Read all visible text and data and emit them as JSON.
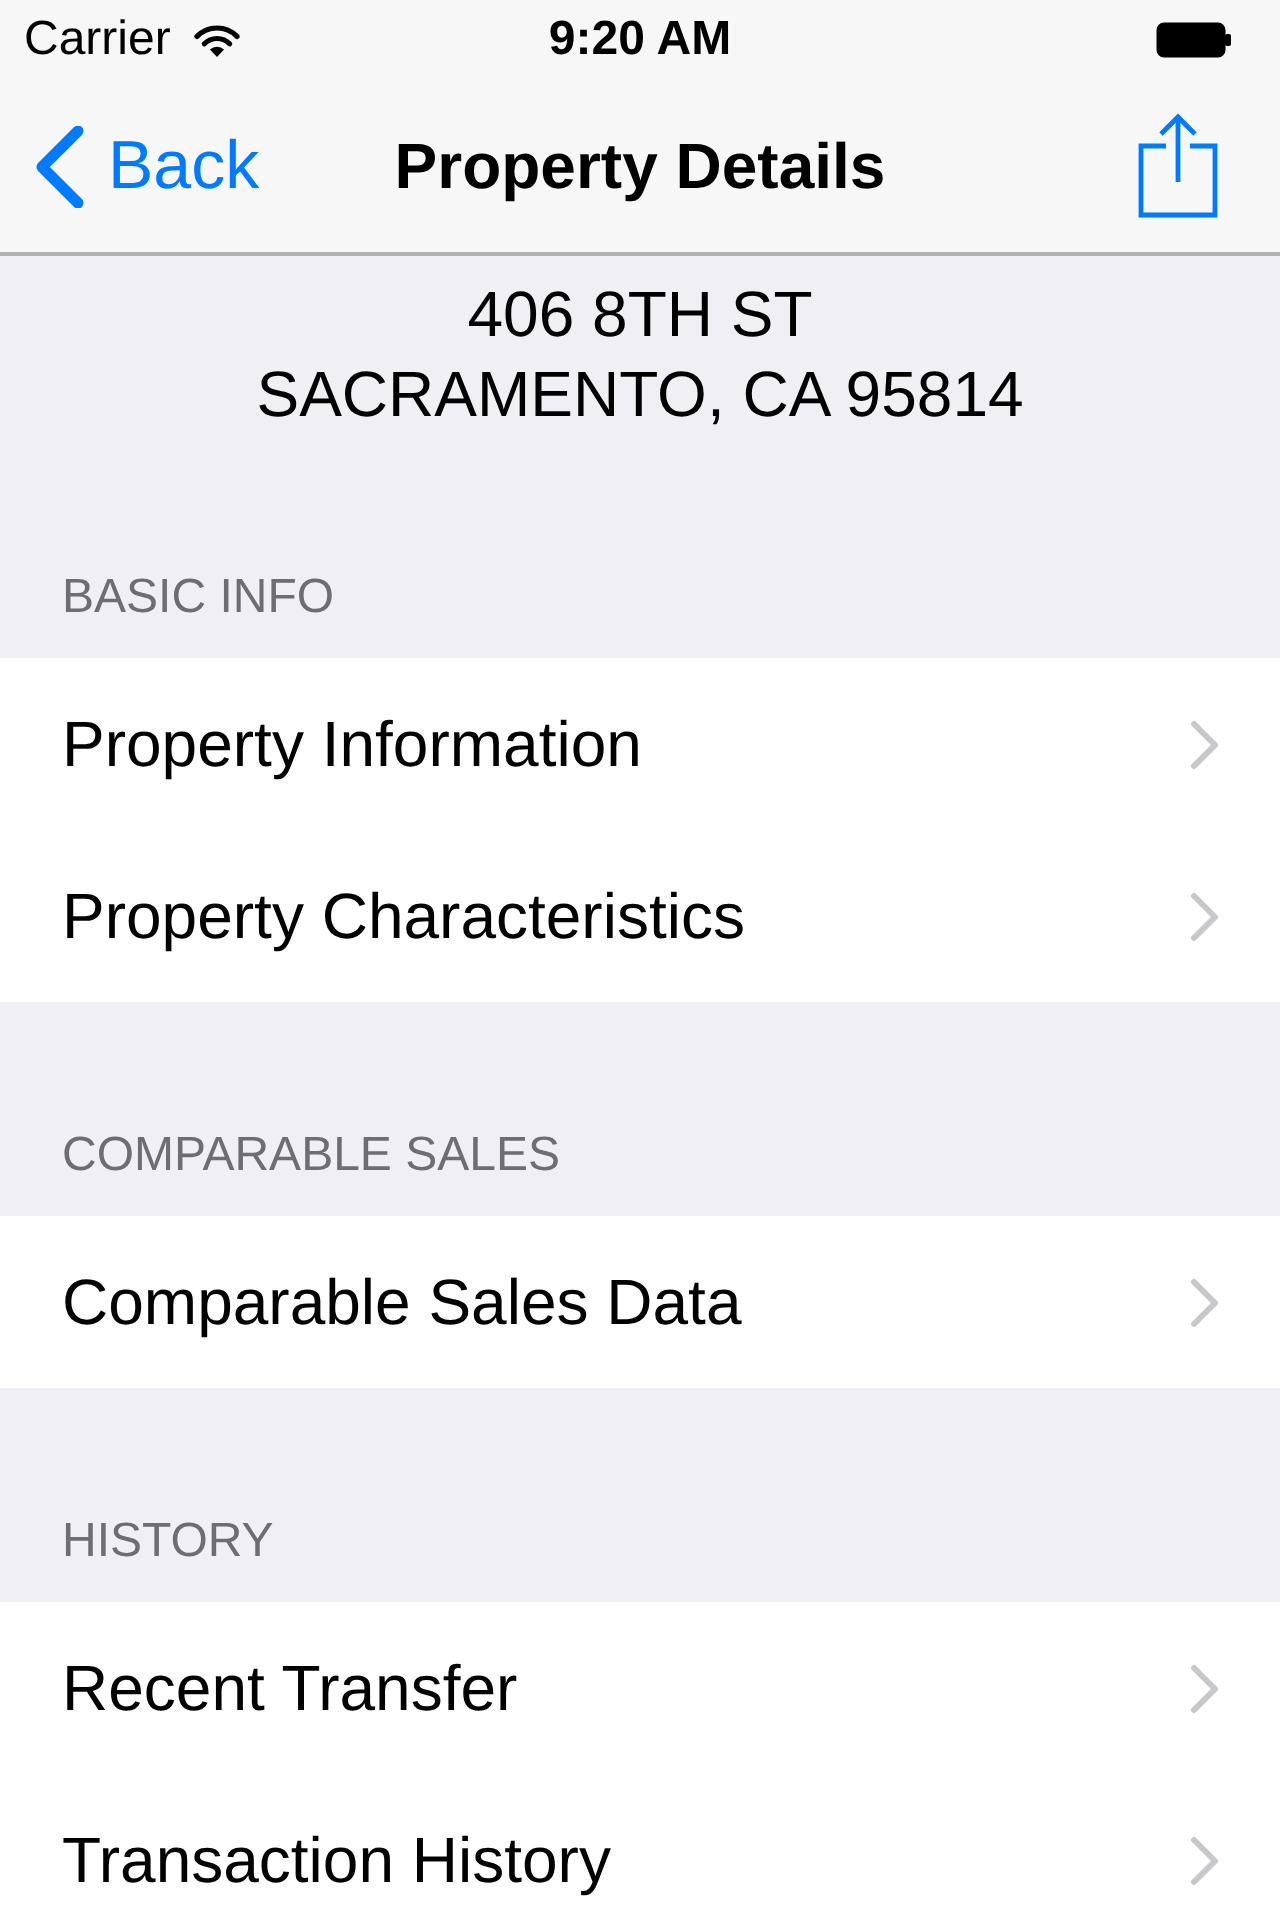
{
  "status_bar": {
    "carrier": "Carrier",
    "time": "9:20 AM"
  },
  "nav_bar": {
    "back_label": "Back",
    "title": "Property Details"
  },
  "address": {
    "lines": [
      "406 8TH ST",
      "SACRAMENTO, CA 95814"
    ]
  },
  "sections": [
    {
      "header": "BASIC INFO",
      "rows": [
        {
          "label": "Property Information"
        },
        {
          "label": "Property Characteristics"
        }
      ]
    },
    {
      "header": "COMPARABLE SALES",
      "rows": [
        {
          "label": "Comparable Sales Data"
        }
      ]
    },
    {
      "header": "HISTORY",
      "rows": [
        {
          "label": "Recent Transfer"
        },
        {
          "label": "Transaction History"
        }
      ]
    }
  ]
}
